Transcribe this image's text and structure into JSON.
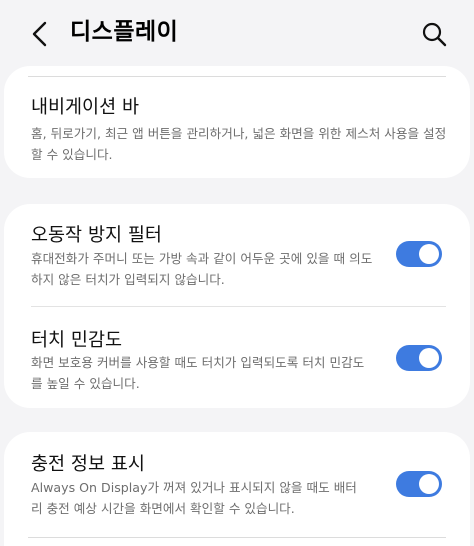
{
  "header": {
    "title": "디스플레이",
    "back_icon": "chevron-left-icon",
    "search_icon": "search-icon"
  },
  "navigation_bar": {
    "title": "내비게이션 바",
    "description_lines": [
      "홈, 뒤로가기, 최근 앱 버튼을 관리하거나, 넓은 화면을 위한 제스처 사용을 설정",
      "할 수 있습니다."
    ]
  },
  "settings": [
    {
      "title": "오동작 방지 필터",
      "description_lines": [
        "휴대전화가 주머니 또는 가방 속과 같이 어두운 곳에 있을 때 의도",
        "하지 않은 터치가 입력되지 않습니다."
      ],
      "enabled": true
    },
    {
      "title": "터치 민감도",
      "description_lines": [
        "화면 보호용 커버를 사용할 때도 터치가 입력되도록 터치 민감도",
        "를 높일 수 있습니다."
      ],
      "enabled": true
    },
    {
      "title": "충전 정보 표시",
      "description_lines": [
        "Always On Display가 꺼져 있거나 표시되지 않을 때도 배터",
        "리 충전 예상 시간을 화면에서 확인할 수 있습니다."
      ],
      "enabled": true
    }
  ],
  "colors": {
    "background": "#f4f4f6",
    "card": "#ffffff",
    "accent": "#3e7be0",
    "secondary_text": "#6e6e6e"
  }
}
